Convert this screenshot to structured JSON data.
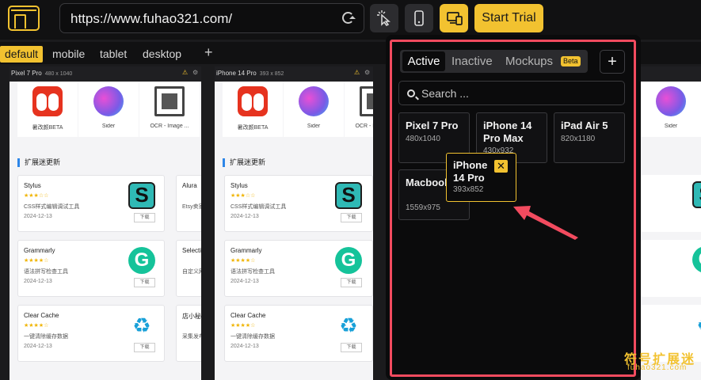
{
  "browser": {
    "url": "https://www.fuhao321.com/",
    "start_trial_label": "Start Trial"
  },
  "view_tabs": [
    "default",
    "mobile",
    "tablet",
    "desktop"
  ],
  "add_tab_label": "+",
  "frames": [
    {
      "name": "Pixel 7 Pro",
      "size": "480 x 1040"
    },
    {
      "name": "iPhone 14 Pro",
      "size": "393 x 852"
    }
  ],
  "apps": [
    {
      "label": "暑改颜BETA"
    },
    {
      "label": "Sider"
    },
    {
      "label": "OCR - Image ..."
    }
  ],
  "section_title": "扩展迷更新",
  "cards": [
    {
      "name": "Stylus",
      "stars": "★★★☆☆",
      "desc": "CSS样式编辑调试工具",
      "date": "2024-12-13",
      "dl": "下载"
    },
    {
      "name": "Grammarly",
      "stars": "★★★★☆",
      "desc": "语法拼写检查工具",
      "date": "2024-12-13",
      "dl": "下载"
    },
    {
      "name": "Clear Cache",
      "stars": "★★★★☆",
      "desc": "一键清除缓存数据",
      "date": "2024-12-13",
      "dl": "下载"
    }
  ],
  "cards_partial": [
    {
      "name": "Alura",
      "desc": "Etsy卖家"
    },
    {
      "name": "Selecti",
      "desc": "自定义网"
    },
    {
      "name": "店小秘",
      "desc": "采集发布"
    }
  ],
  "popup": {
    "tabs": [
      "Active",
      "Inactive",
      "Mockups"
    ],
    "beta_label": "Beta",
    "add_label": "+",
    "search_placeholder": "Search ...",
    "devices": [
      {
        "name": "Pixel 7 Pro",
        "size": "480x1040"
      },
      {
        "name": "iPhone 14 Pro Max",
        "size": "430x932"
      },
      {
        "name": "iPad Air 5",
        "size": "820x1180"
      },
      {
        "name": "Macbook Air",
        "size": "1559x975"
      }
    ],
    "dragging": {
      "name": "iPhone 14 Pro",
      "size": "393x852"
    }
  },
  "watermark": {
    "text": "符号扩展迷",
    "sub": "fuhao321.com"
  },
  "colors": {
    "accent": "#f2c230",
    "highlight": "#f24b5f"
  }
}
